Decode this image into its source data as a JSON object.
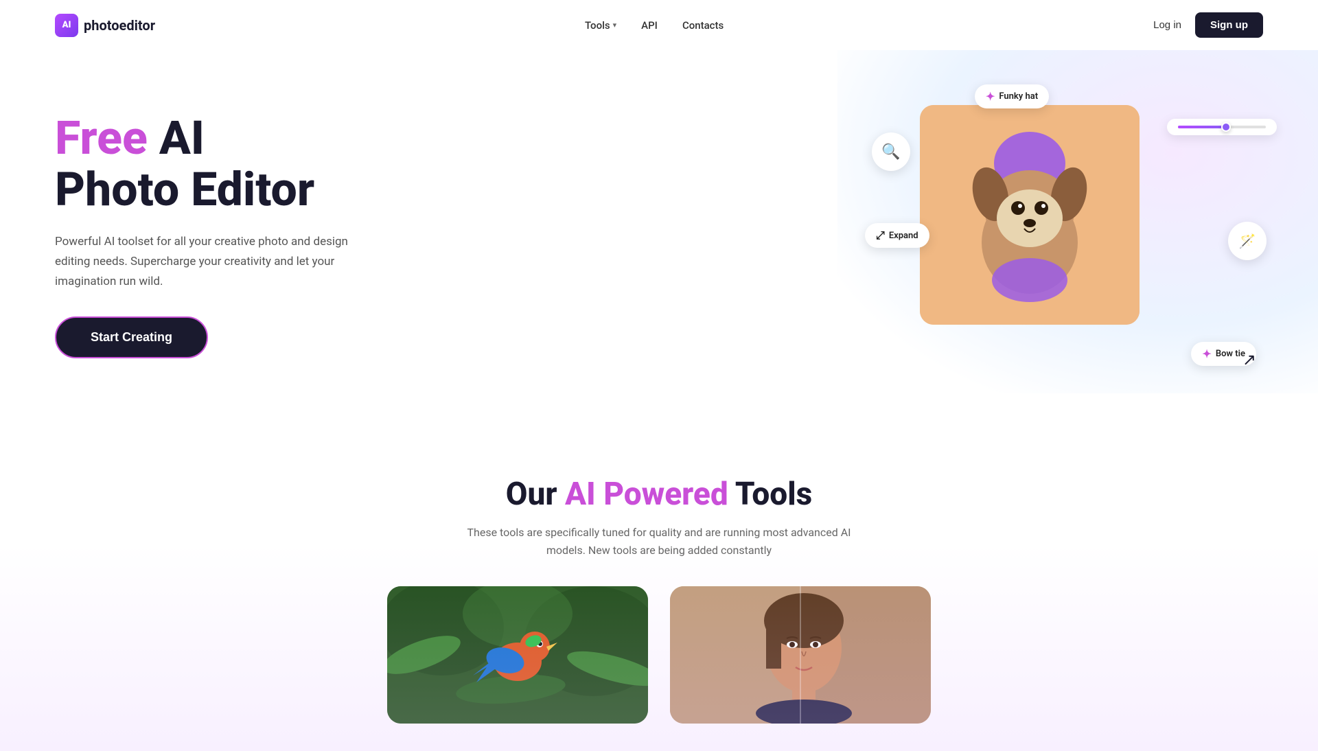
{
  "nav": {
    "logo_text_photo": "photo",
    "logo_text_editor": "editor",
    "logo_icon_text": "AI",
    "links": [
      {
        "id": "tools",
        "label": "Tools",
        "has_dropdown": true
      },
      {
        "id": "api",
        "label": "API"
      },
      {
        "id": "contacts",
        "label": "Contacts"
      }
    ],
    "login_label": "Log in",
    "signup_label": "Sign up"
  },
  "hero": {
    "title_free": "Free",
    "title_rest": " AI\nPhoto Editor",
    "description": "Powerful AI toolset for all your creative photo and design editing needs. Supercharge your creativity and let your imagination run wild.",
    "cta_label": "Start Creating",
    "chip_funky_hat": "Funky hat",
    "chip_bow_tie": "Bow tie",
    "chip_expand": "Expand"
  },
  "tools_section": {
    "title_our": "Our ",
    "title_ai_powered": "AI Powered",
    "title_tools": " Tools",
    "description": "These tools are specifically tuned for quality and are running most advanced AI models. New tools are being added constantly",
    "cards": [
      {
        "id": "bird",
        "bg": "#3a7a30"
      },
      {
        "id": "portrait",
        "bg": "#c8a882"
      }
    ]
  },
  "icons": {
    "search_plus": "🔍",
    "magic_wand": "✨",
    "sparkle": "✦",
    "expand_arrows": "⤢",
    "dropdown_arrow": "▾",
    "cursor": "↗"
  }
}
